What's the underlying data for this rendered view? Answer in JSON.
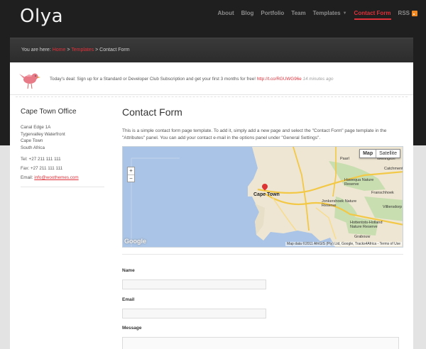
{
  "site": {
    "title": "Olya"
  },
  "nav": {
    "items": [
      {
        "label": "About"
      },
      {
        "label": "Blog"
      },
      {
        "label": "Portfolio"
      },
      {
        "label": "Team"
      },
      {
        "label": "Templates",
        "dropdown": true
      },
      {
        "label": "Contact Form",
        "active": true
      },
      {
        "label": "RSS"
      }
    ],
    "rss_icon": "rss-icon"
  },
  "breadcrumb": {
    "prefix": "You are here: ",
    "home": "Home",
    "sep1": " > ",
    "templates": "Templates",
    "sep2": " > ",
    "current": "Contact Form"
  },
  "deal": {
    "text": "Today's deal: Sign up for a Standard or Developer Club Subscription and get your first 3 months for free! ",
    "link": "http://t.co/RGUWG96e",
    "ago": " 14 minutes ago",
    "icon": "bird-icon"
  },
  "sidebar": {
    "heading": "Cape Town Office",
    "address": [
      "Canal Edge 1A",
      "Tygervalley Waterfront",
      "Cape Town",
      "South Africa"
    ],
    "tel": "Tel: +27 211 111 111",
    "fax": "Fax: +27 211 111 111",
    "email_label": "Email: ",
    "email": "info@woothemes.com"
  },
  "content": {
    "heading": "Contact Form",
    "intro": "This is a simple contact form page template. To add it, simply add a new page and select the \"Contact Form\" page template in the \"Attributes\" panel. You can add your contact e-mail in the options panel under \"General Settings\"."
  },
  "map": {
    "tab_map": "Map",
    "tab_satellite": "Satellite",
    "zoom_in": "+",
    "zoom_out": "−",
    "logo": "Google",
    "attribution": "Map data ©2011 AfriGIS (Pty) Ltd, Google, Tracks4Africa - Terms of Use",
    "labels": {
      "cape_town": "Cape Town",
      "paarl": "Paarl",
      "hawequa": "Hawequa Nature Reserve",
      "jonkershoek": "Jonkershoek Nature Reserve",
      "hottentots": "Hottentots-Holland Nature Reserve",
      "franschhoek": "Franschhoek",
      "villiersdorp": "Villiersdorp",
      "grabouw": "Grabouw",
      "wellington": "Wellington",
      "catchment": "Catchment"
    },
    "colors": {
      "water": "#a9c4e6",
      "land": "#eee6d2",
      "park": "#c8deb0",
      "road": "#f2c846"
    }
  },
  "form": {
    "name_label": "Name",
    "email_label": "Email",
    "message_label": "Message"
  }
}
